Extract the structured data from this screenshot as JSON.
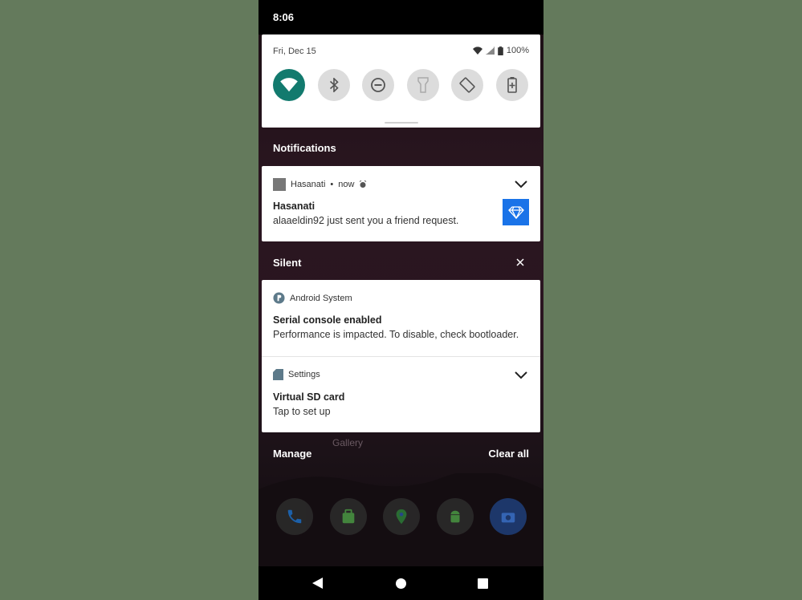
{
  "status_bar": {
    "time": "8:06"
  },
  "quick_settings": {
    "date": "Fri, Dec 15",
    "battery": "100%",
    "tiles": [
      {
        "name": "wifi",
        "active": true
      },
      {
        "name": "bluetooth",
        "active": false
      },
      {
        "name": "do-not-disturb",
        "active": false
      },
      {
        "name": "flashlight",
        "active": false
      },
      {
        "name": "auto-rotate",
        "active": false
      },
      {
        "name": "battery-saver",
        "active": false
      }
    ]
  },
  "notifications": {
    "header": "Notifications",
    "items": [
      {
        "app": "Hasanati",
        "time": "now",
        "title": "Hasanati",
        "text": "alaaeldin92 just sent you a friend request.",
        "thumb_color": "#1a73e8"
      }
    ]
  },
  "silent": {
    "header": "Silent",
    "items": [
      {
        "app": "Android System",
        "title": "Serial console enabled",
        "text": "Performance is impacted. To disable, check bootloader."
      },
      {
        "app": "Settings",
        "title": "Virtual SD card",
        "text": "Tap to set up"
      }
    ]
  },
  "footer": {
    "manage": "Manage",
    "clear_all": "Clear all"
  },
  "home": {
    "gallery_label": "Gallery"
  },
  "colors": {
    "accent": "#127a6e",
    "background": "#647a5c"
  }
}
